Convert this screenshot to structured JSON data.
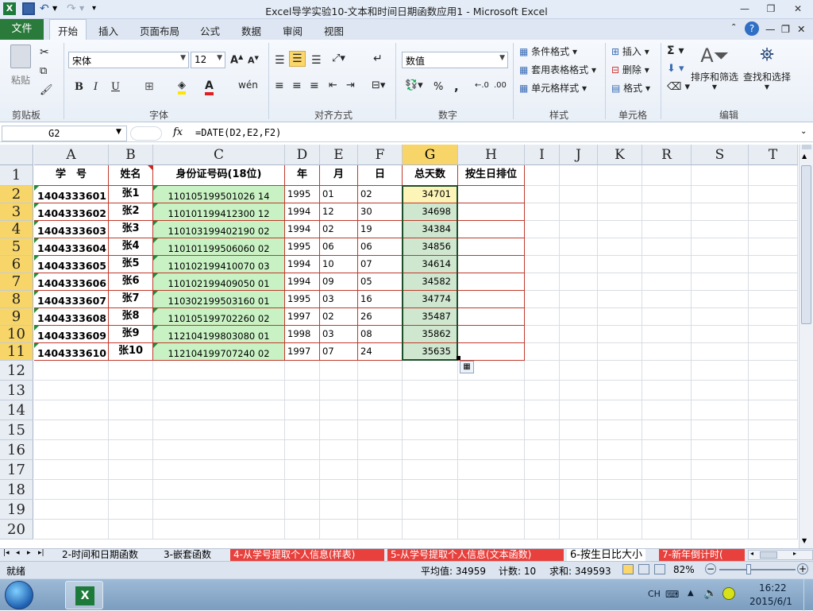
{
  "window": {
    "title": "Excel导学实验10-文本和时间日期函数应用1  -  Microsoft Excel"
  },
  "ribbon_tabs": [
    "文件",
    "开始",
    "插入",
    "页面布局",
    "公式",
    "数据",
    "审阅",
    "视图"
  ],
  "ribbon": {
    "clipboard": {
      "label": "剪贴板",
      "paste": "粘贴"
    },
    "font": {
      "label": "字体",
      "font_name": "宋体",
      "font_size": "12",
      "bold": "B",
      "italic": "I",
      "underline": "U"
    },
    "alignment": {
      "label": "对齐方式"
    },
    "number": {
      "label": "数字",
      "format": "数值",
      "percent": "%",
      "comma": ","
    },
    "styles": {
      "label": "样式",
      "conditional": "条件格式",
      "table": "套用表格格式",
      "cell_styles": "单元格样式"
    },
    "cells": {
      "label": "单元格",
      "insert": "插入",
      "delete": "删除",
      "format": "格式"
    },
    "editing": {
      "label": "编辑",
      "sort_filter": "排序和筛选",
      "find_select": "查找和选择"
    }
  },
  "formula_bar": {
    "name_box": "G2",
    "fx": "fx",
    "formula": "=DATE(D2,E2,F2)"
  },
  "columns": [
    {
      "letter": "A",
      "selected": false
    },
    {
      "letter": "B",
      "selected": false
    },
    {
      "letter": "C",
      "selected": false
    },
    {
      "letter": "D",
      "selected": false
    },
    {
      "letter": "E",
      "selected": false
    },
    {
      "letter": "F",
      "selected": false
    },
    {
      "letter": "G",
      "selected": true
    },
    {
      "letter": "H",
      "selected": false
    },
    {
      "letter": "I",
      "selected": false
    },
    {
      "letter": "J",
      "selected": false
    },
    {
      "letter": "K",
      "selected": false
    },
    {
      "letter": "R",
      "selected": false
    },
    {
      "letter": "S",
      "selected": false
    },
    {
      "letter": "T",
      "selected": false
    }
  ],
  "row_numbers": [
    "1",
    "2",
    "3",
    "4",
    "5",
    "6",
    "7",
    "8",
    "9",
    "10",
    "11",
    "12",
    "13",
    "14",
    "15",
    "16",
    "17",
    "18",
    "19",
    "20"
  ],
  "table": {
    "headers": [
      "学　号",
      "姓名",
      "身份证号码(18位)",
      "年",
      "月",
      "日",
      "总天数",
      "按生日排位"
    ],
    "rows": [
      [
        "1404333601",
        "张1",
        "110105199501026 14",
        "1995",
        "01",
        "02",
        "34701",
        ""
      ],
      [
        "1404333602",
        "张2",
        "110101199412300 12",
        "1994",
        "12",
        "30",
        "34698",
        ""
      ],
      [
        "1404333603",
        "张3",
        "110103199402190 02",
        "1994",
        "02",
        "19",
        "34384",
        ""
      ],
      [
        "1404333604",
        "张4",
        "110101199506060 02",
        "1995",
        "06",
        "06",
        "34856",
        ""
      ],
      [
        "1404333605",
        "张5",
        "110102199410070 03",
        "1994",
        "10",
        "07",
        "34614",
        ""
      ],
      [
        "1404333606",
        "张6",
        "110102199409050 01",
        "1994",
        "09",
        "05",
        "34582",
        ""
      ],
      [
        "1404333607",
        "张7",
        "110302199503160 01",
        "1995",
        "03",
        "16",
        "34774",
        ""
      ],
      [
        "1404333608",
        "张8",
        "110105199702260 02",
        "1997",
        "02",
        "26",
        "35487",
        ""
      ],
      [
        "1404333609",
        "张9",
        "112104199803080 01",
        "1998",
        "03",
        "08",
        "35862",
        ""
      ],
      [
        "1404333610",
        "张10",
        "112104199707240 02",
        "1997",
        "07",
        "24",
        "35635",
        ""
      ]
    ]
  },
  "sheet_tabs": [
    {
      "label": "2-时间和日期函数",
      "style": "normal"
    },
    {
      "label": "3-嵌套函数",
      "style": "normal"
    },
    {
      "label": "4-从学号提取个人信息(样表)",
      "style": "red"
    },
    {
      "label": "5-从学号提取个人信息(文本函数)",
      "style": "red"
    },
    {
      "label": "6-按生日比大小",
      "style": "active"
    },
    {
      "label": "7-新年倒计时(",
      "style": "red"
    }
  ],
  "status": {
    "mode": "就绪",
    "average": "平均值: 34959",
    "count": "计数: 10",
    "sum": "求和: 349593",
    "zoom": "82%"
  },
  "taskbar": {
    "lang": "CH",
    "time": "16:22",
    "date": "2015/6/1"
  },
  "colors": {
    "file_tab": "#2a7a3b",
    "selected_header": "#f7d568",
    "id_fill": "#c9f2c4",
    "border_red": "#c0392b",
    "tab_red": "#e8403c"
  }
}
